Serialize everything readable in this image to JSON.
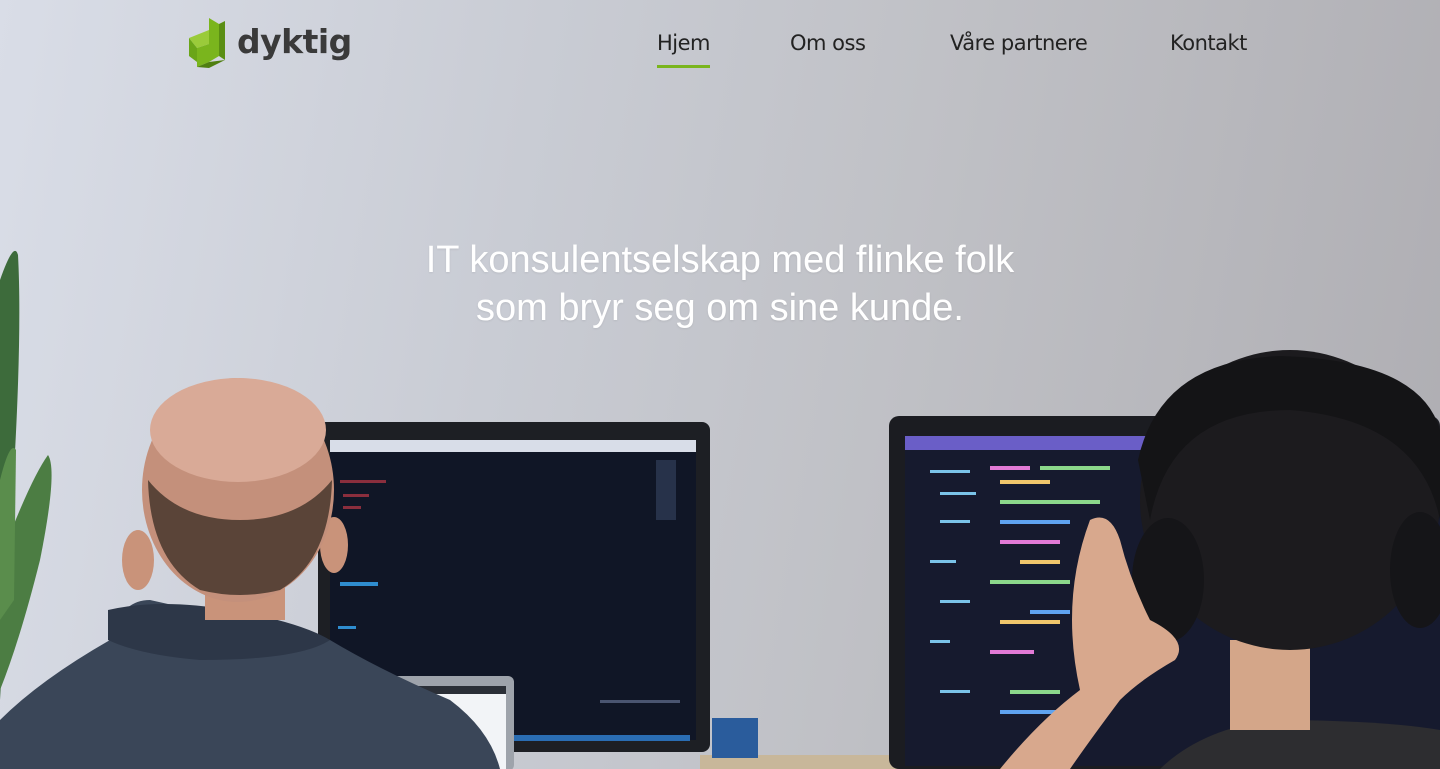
{
  "brand": {
    "name": "dyktig",
    "accent_color": "#7ab51d"
  },
  "nav": {
    "items": [
      {
        "label": "Hjem",
        "active": true
      },
      {
        "label": "Om oss",
        "active": false
      },
      {
        "label": "Våre partnere",
        "active": false
      },
      {
        "label": "Kontakt",
        "active": false
      }
    ]
  },
  "hero": {
    "headline_line1": "IT konsulentselskap med flinke folk",
    "headline_line2": "som bryr seg om sine kunde.",
    "image": "photo-two-developers-at-monitors"
  }
}
